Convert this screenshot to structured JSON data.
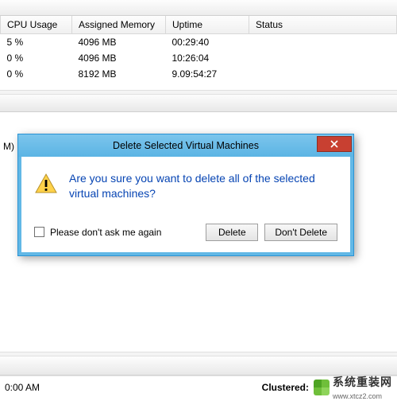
{
  "table": {
    "headers": {
      "cpu": "CPU Usage",
      "mem": "Assigned Memory",
      "uptime": "Uptime",
      "status": "Status"
    },
    "rows": [
      {
        "cpu": "5 %",
        "mem": "4096 MB",
        "uptime": "00:29:40",
        "status": ""
      },
      {
        "cpu": "0 %",
        "mem": "4096 MB",
        "uptime": "10:26:04",
        "status": ""
      },
      {
        "cpu": "0 %",
        "mem": "8192 MB",
        "uptime": "9.09:54:27",
        "status": ""
      }
    ]
  },
  "details": {
    "label_fragment": "M)"
  },
  "dialog": {
    "title": "Delete Selected Virtual Machines",
    "message": "Are you sure you want to delete all of the selected virtual machines?",
    "dont_ask": "Please don't ask me again",
    "delete": "Delete",
    "dont_delete": "Don't Delete"
  },
  "statusbar": {
    "time_fragment": "0:00 AM",
    "clustered": "Clustered:"
  },
  "watermark": {
    "text": "系统重装网",
    "url": "www.xtcz2.com"
  }
}
